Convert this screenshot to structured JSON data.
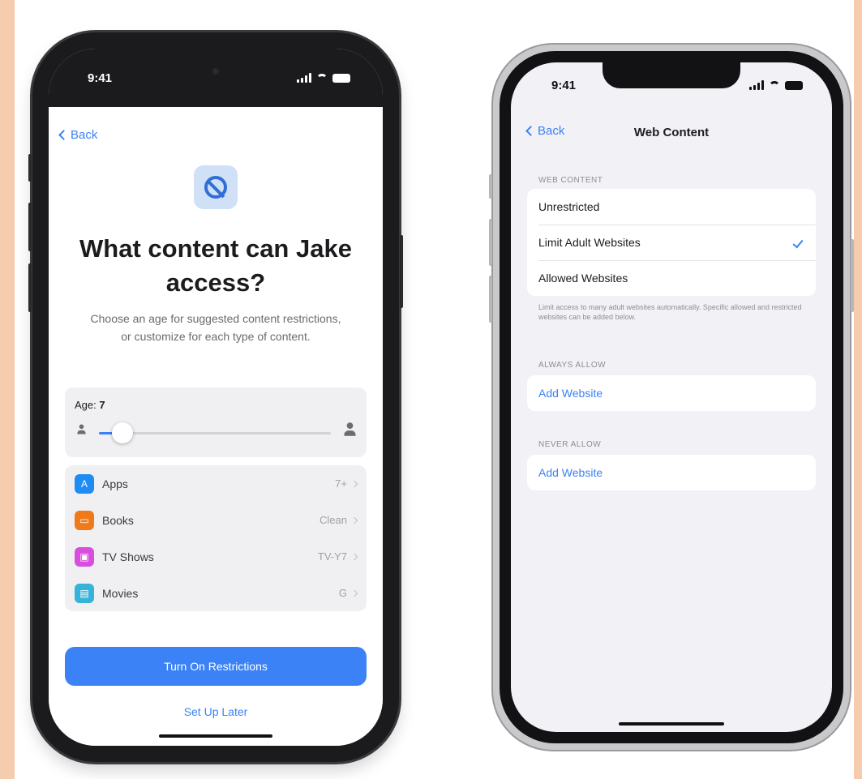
{
  "left_phone": {
    "status_time": "9:41",
    "back_label": "Back",
    "title": "What content can Jake access?",
    "subtitle": "Choose an age for suggested content restrictions, or customize for each type of content.",
    "age": {
      "label": "Age:",
      "value": "7",
      "slider_fraction": 0.1
    },
    "content_rows": [
      {
        "label": "Apps",
        "value": "7+",
        "icon": "app-store-icon",
        "color": "#1f8cf5"
      },
      {
        "label": "Books",
        "value": "Clean",
        "icon": "books-icon",
        "color": "#f07a1a"
      },
      {
        "label": "TV Shows",
        "value": "TV-Y7",
        "icon": "tv-icon",
        "color": "#d84fe0"
      },
      {
        "label": "Movies",
        "value": "G",
        "icon": "movies-icon",
        "color": "#35b3d8"
      }
    ],
    "primary_button": "Turn On Restrictions",
    "secondary_button": "Set Up Later"
  },
  "right_phone": {
    "status_time": "9:41",
    "back_label": "Back",
    "nav_title": "Web Content",
    "section_web_content": "WEB CONTENT",
    "options": [
      {
        "label": "Unrestricted",
        "selected": false
      },
      {
        "label": "Limit Adult Websites",
        "selected": true
      },
      {
        "label": "Allowed Websites",
        "selected": false
      }
    ],
    "footnote": "Limit access to many adult websites automatically. Specific allowed and restricted websites can be added below.",
    "section_always_allow": "ALWAYS ALLOW",
    "always_allow_action": "Add Website",
    "section_never_allow": "NEVER ALLOW",
    "never_allow_action": "Add Website"
  },
  "colors": {
    "background": "#f6ccae",
    "accent": "#3b82f6",
    "frame": "#1b1b1d"
  }
}
